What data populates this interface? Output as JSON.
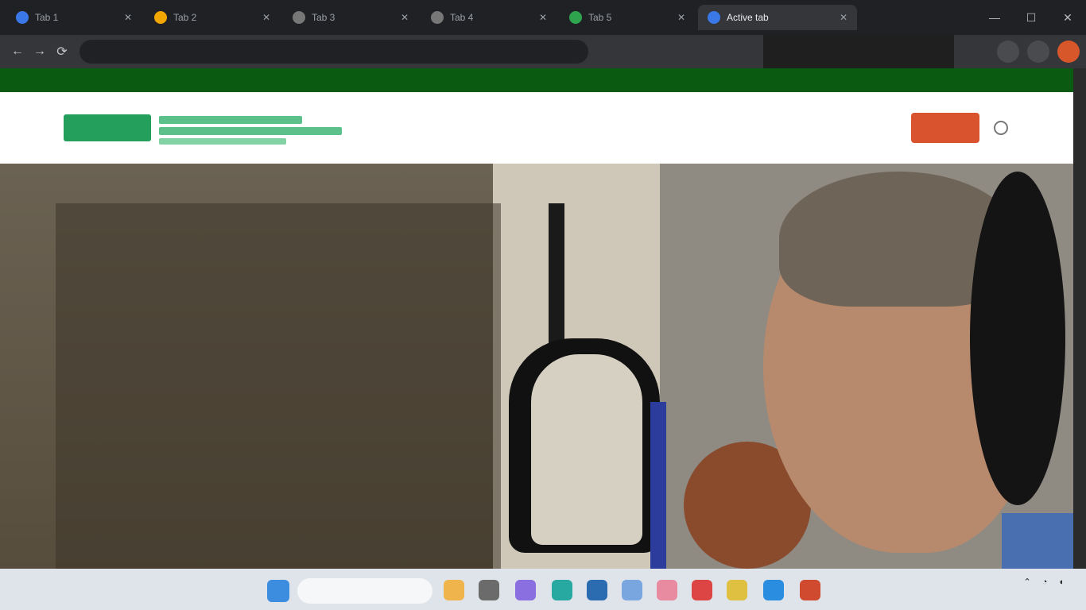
{
  "browser": {
    "tabs": [
      {
        "label": "Tab 1",
        "favicon_color": "#3b78e7"
      },
      {
        "label": "Tab 2",
        "favicon_color": "#f2a600"
      },
      {
        "label": "Tab 3",
        "favicon_color": "#777777"
      },
      {
        "label": "Tab 4",
        "favicon_color": "#777777"
      },
      {
        "label": "Tab 5",
        "favicon_color": "#2fa44f"
      },
      {
        "label": "Active tab",
        "favicon_color": "#3b78e7"
      }
    ],
    "url": "",
    "controls": {
      "back": "←",
      "forward": "→",
      "reload": "⟳",
      "minimize": "—",
      "maximize": "☐",
      "close": "✕"
    }
  },
  "profile_menu": {
    "line1": "",
    "line2": ""
  },
  "site": {
    "topbar": [
      "",
      "",
      ""
    ],
    "nav": [
      "",
      "",
      "",
      "",
      "",
      ""
    ],
    "donate_label": "",
    "colors": {
      "brand_green": "#24a05c",
      "topbar_green": "#0a5a12",
      "donate": "#d9532f"
    }
  },
  "hero": {
    "kicker": "",
    "headline": "",
    "body": ""
  },
  "taskbar": {
    "search_placeholder": "",
    "weather": "",
    "time": "",
    "date": "",
    "apps": [
      "#f0b44c",
      "#6b6b6b",
      "#8a6fe0",
      "#27a8a0",
      "#2b6cb0",
      "#7aa6e0",
      "#e88aa0",
      "#d44",
      "#e0c040",
      "#2b8de0",
      "#d04a30"
    ]
  }
}
